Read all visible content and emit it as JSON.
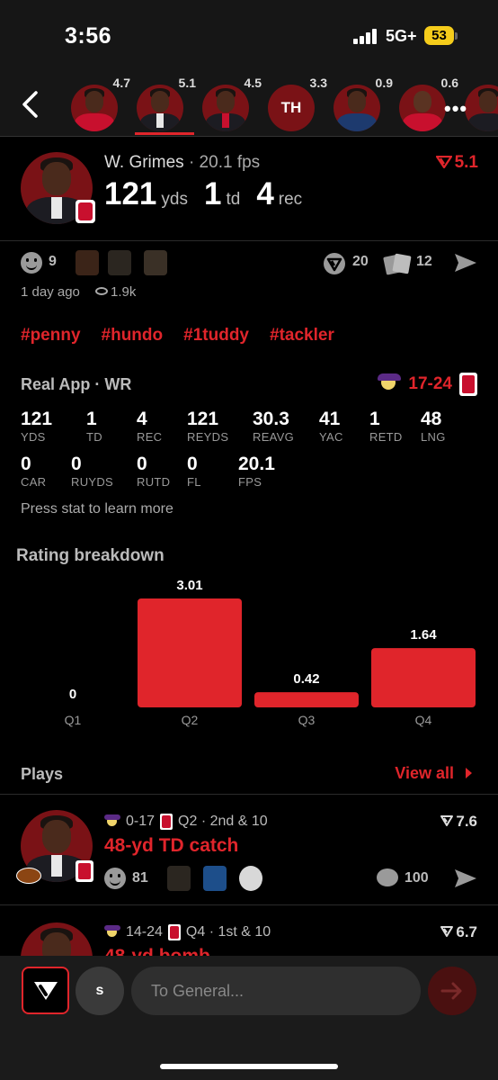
{
  "status_bar": {
    "time": "3:56",
    "network": "5G+",
    "battery": "53"
  },
  "player_strip": {
    "items": [
      {
        "score": "4.7",
        "initials": ""
      },
      {
        "score": "5.1",
        "initials": ""
      },
      {
        "score": "4.5",
        "initials": ""
      },
      {
        "score": "3.3",
        "initials": "TH"
      },
      {
        "score": "0.9",
        "initials": ""
      },
      {
        "score": "0.6",
        "initials": ""
      }
    ],
    "more": "•••"
  },
  "hero": {
    "name": "W. Grimes",
    "fps_label": " · 20.1 fps",
    "rating": "5.1",
    "stats": [
      {
        "num": "121",
        "unit": "yds"
      },
      {
        "num": "1",
        "unit": "td"
      },
      {
        "num": "4",
        "unit": "rec"
      }
    ]
  },
  "engagement": {
    "reactions_count": "9",
    "predictions_count": "20",
    "cards_count": "12",
    "time_ago": "1 day ago",
    "views": "1.9k"
  },
  "hashtags": [
    "#penny",
    "#hundo",
    "#1tuddy",
    "#tackler"
  ],
  "stats": {
    "title": "Real App · WR",
    "game_score": "17-24",
    "row1": [
      {
        "value": "121",
        "label": "YDS"
      },
      {
        "value": "1",
        "label": "TD"
      },
      {
        "value": "4",
        "label": "REC"
      },
      {
        "value": "121",
        "label": "REYDS"
      },
      {
        "value": "30.3",
        "label": "REAVG"
      },
      {
        "value": "41",
        "label": "YAC"
      },
      {
        "value": "1",
        "label": "RETD"
      },
      {
        "value": "48",
        "label": "LNG"
      }
    ],
    "row2": [
      {
        "value": "0",
        "label": "CAR"
      },
      {
        "value": "0",
        "label": "RUYDS"
      },
      {
        "value": "0",
        "label": "RUTD"
      },
      {
        "value": "0",
        "label": "FL"
      },
      {
        "value": "20.1",
        "label": "FPS"
      }
    ],
    "hint": "Press stat to learn more"
  },
  "rating_breakdown": {
    "title": "Rating breakdown"
  },
  "chart_data": {
    "type": "bar",
    "title": "Rating breakdown",
    "categories": [
      "Q1",
      "Q2",
      "Q3",
      "Q4"
    ],
    "values": [
      0,
      3.01,
      0.42,
      1.64
    ],
    "value_labels": [
      "0",
      "3.01",
      "0.42",
      "1.64"
    ],
    "ylim": [
      0,
      3.01
    ],
    "grid": false,
    "bar_color": "#e0252b"
  },
  "plays": {
    "title": "Plays",
    "view_all": "View all",
    "items": [
      {
        "score": "0-17",
        "situation": "Q2 · 2nd & 10",
        "rating": "7.6",
        "title": "48-yd TD catch",
        "reactions": "81",
        "comments": "100"
      },
      {
        "score": "14-24",
        "situation": "Q4 · 1st & 10",
        "rating": "6.7",
        "title": "48-yd bomb"
      }
    ]
  },
  "input_bar": {
    "user_initial": "s",
    "placeholder": "To General..."
  },
  "colors": {
    "accent": "#e0252b",
    "background": "#000000",
    "surface": "#161616"
  }
}
